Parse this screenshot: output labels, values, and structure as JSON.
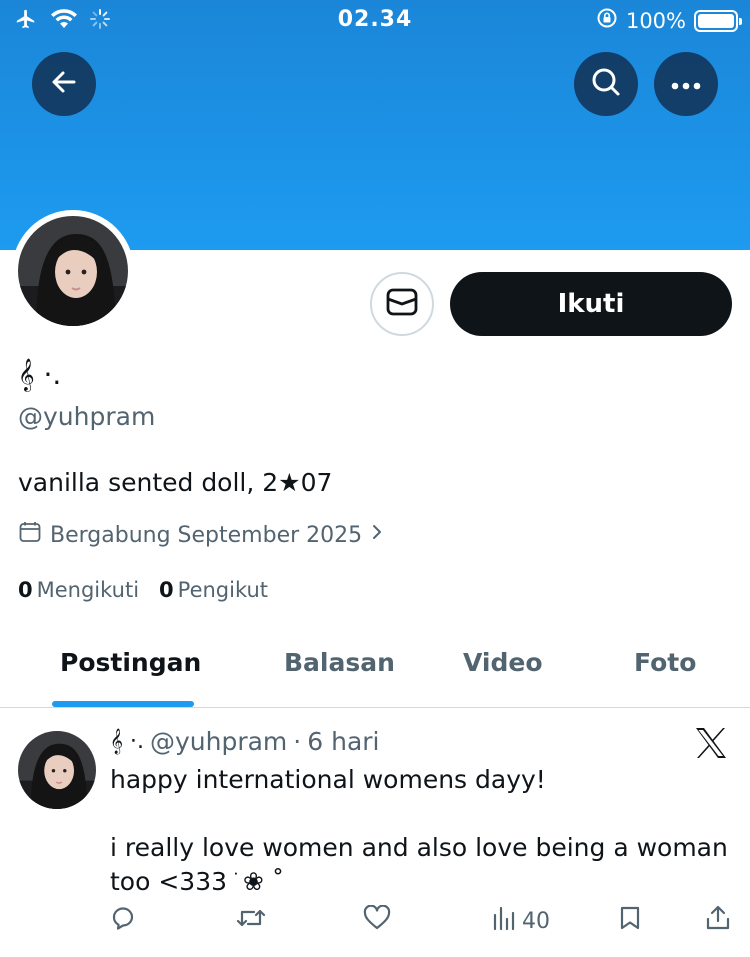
{
  "status_bar": {
    "time": "02.34",
    "battery_text": "100%",
    "battery_level": 1.0
  },
  "header": {
    "banner_color": "#1d9bf0"
  },
  "profile": {
    "display_name": "𝄞 ⋅.",
    "handle": "@yuhpram",
    "bio": "vanilla sented doll, 2★07",
    "joined": "Bergabung September 2025",
    "following_count": "0",
    "following_label": "Mengikuti",
    "followers_count": "0",
    "followers_label": "Pengikut",
    "follow_label": "Ikuti"
  },
  "tabs": [
    {
      "label": "Postingan",
      "active": true
    },
    {
      "label": "Balasan",
      "active": false
    },
    {
      "label": "Video",
      "active": false
    },
    {
      "label": "Foto",
      "active": false
    }
  ],
  "post": {
    "author_name": "𝄞 ⋅.",
    "author_handle": "@yuhpram",
    "separator": "·",
    "time": "6 hari",
    "text": "happy international womens dayy!\n\ni really love women and also love being a woman too <333 ֹ ❀ ˚",
    "views": "40"
  },
  "colors": {
    "accent": "#1d9bf0",
    "text_primary": "#0f1419",
    "text_secondary": "#536471",
    "divider": "#cfd9de"
  },
  "icons": {
    "back": "arrow-left-icon",
    "search": "search-icon",
    "more": "more-icon",
    "message": "mail-icon",
    "calendar": "calendar-icon",
    "reply": "reply-icon",
    "repost": "repost-icon",
    "like": "heart-icon",
    "views": "views-icon",
    "bookmark": "bookmark-icon",
    "share": "share-icon",
    "x_logo": "x-logo-icon"
  }
}
